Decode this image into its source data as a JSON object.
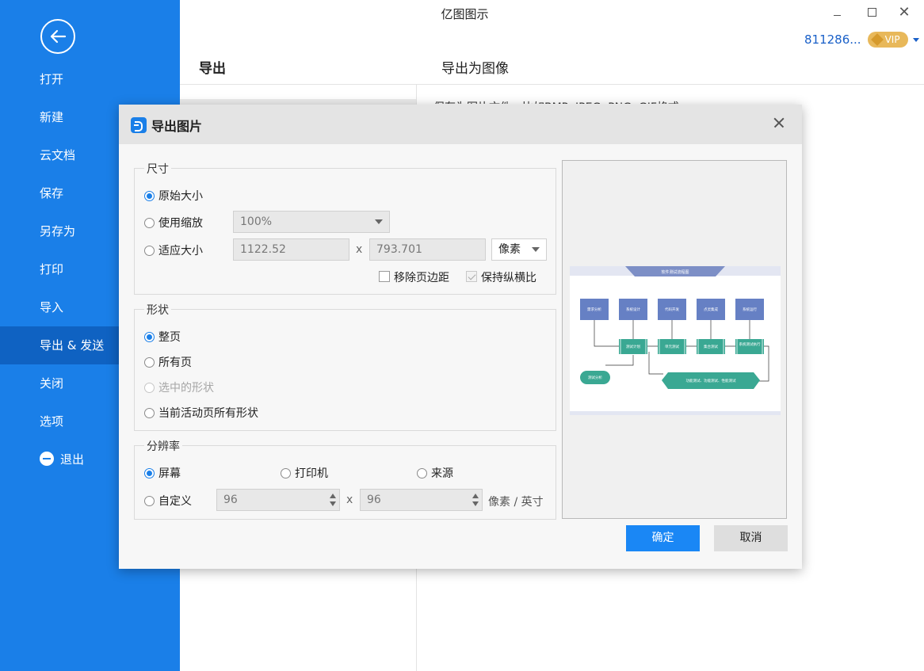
{
  "app": {
    "title": "亿图图示"
  },
  "account": {
    "id": "811286...",
    "badge": "VIP"
  },
  "sidebar": {
    "items": [
      {
        "label": "打开"
      },
      {
        "label": "新建"
      },
      {
        "label": "云文档"
      },
      {
        "label": "保存"
      },
      {
        "label": "另存为"
      },
      {
        "label": "打印"
      },
      {
        "label": "导入"
      },
      {
        "label": "导出 & 发送",
        "active": true
      },
      {
        "label": "关闭"
      },
      {
        "label": "选项"
      },
      {
        "label": "退出"
      }
    ]
  },
  "main": {
    "heading": "导出",
    "sub_heading": "导出为图像",
    "description": "保存为图片文件，比如BMP, JPEG, PNG, GIF格式。"
  },
  "dialog": {
    "title": "导出图片",
    "size": {
      "legend": "尺寸",
      "original": "原始大小",
      "use_zoom": "使用缩放",
      "zoom_value": "100%",
      "fit_size": "适应大小",
      "width": "1122.52",
      "x_label": "x",
      "height": "793.701",
      "unit": "像素",
      "remove_margin": "移除页边距",
      "keep_ratio": "保持纵横比"
    },
    "shape": {
      "legend": "形状",
      "whole_page": "整页",
      "all_pages": "所有页",
      "selected_shapes": "选中的形状",
      "active_page_shapes": "当前活动页所有形状"
    },
    "resolution": {
      "legend": "分辨率",
      "screen": "屏幕",
      "printer": "打印机",
      "source": "来源",
      "custom": "自定义",
      "dpi_x": "96",
      "x_label": "x",
      "dpi_y": "96",
      "unit": "像素 / 英寸"
    },
    "buttons": {
      "ok": "确定",
      "cancel": "取消"
    }
  },
  "preview": {
    "title": "软件测试流程图",
    "top_nodes": [
      "需求分析",
      "系统设计",
      "代码开发",
      "点灵集成",
      "系统运行"
    ],
    "mid_nodes": [
      "测试计划",
      "单元测试",
      "集合测试",
      "系统测试执行"
    ],
    "left_node": "测试分析",
    "bottom_node": "功能测试、功能测试、性能测试",
    "colors": {
      "blue": "#6680c4",
      "teal": "#3aa893",
      "header": "#7d8fc6"
    }
  }
}
